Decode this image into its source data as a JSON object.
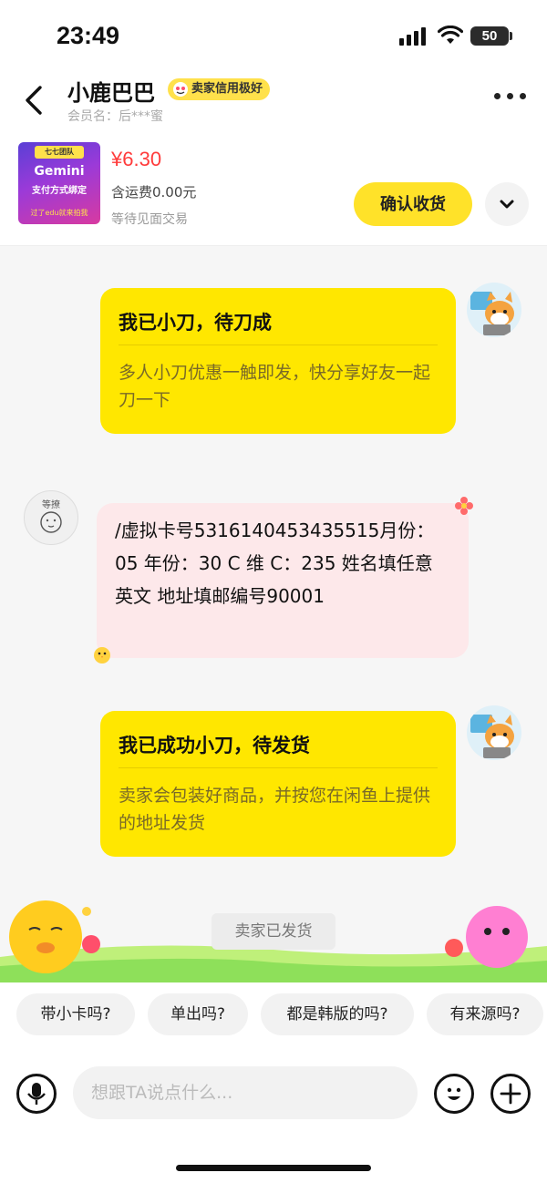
{
  "status_bar": {
    "time": "23:49",
    "battery": "50"
  },
  "header": {
    "seller_name": "小鹿巴巴",
    "credit_badge": "卖家信用极好",
    "member_label": "会员名：后***蜜"
  },
  "product": {
    "thumb_tag": "七七团队",
    "thumb_title": "Gemini",
    "thumb_subtitle": "支付方式绑定",
    "thumb_footer": "过了edu就来拍我",
    "price": "¥6.30",
    "shipping": "含运费0.00元",
    "status": "等待见面交易",
    "confirm_label": "确认收货"
  },
  "messages": [
    {
      "title": "我已小刀，待刀成",
      "body": "多人小刀优惠一触即发，快分享好友一起刀一下"
    },
    {
      "text": "/虚拟卡号5316140453435515月份：05 年份：30  C 维 C：235   姓名填任意英文    地址填邮编号90001"
    },
    {
      "title": "我已成功小刀，待发货",
      "body": "卖家会包装好商品，并按您在闲鱼上提供的地址发货"
    }
  ],
  "seller_avatar_label": "等撩",
  "system_tip": "卖家已发货",
  "quick_replies": [
    "带小卡吗?",
    "单出吗?",
    "都是韩版的吗?",
    "有来源吗?"
  ],
  "input": {
    "placeholder": "想跟TA说点什么..."
  },
  "colors": {
    "accent": "#ffe700",
    "price": "#ff3b3b",
    "bubble": "#fde8ea"
  }
}
